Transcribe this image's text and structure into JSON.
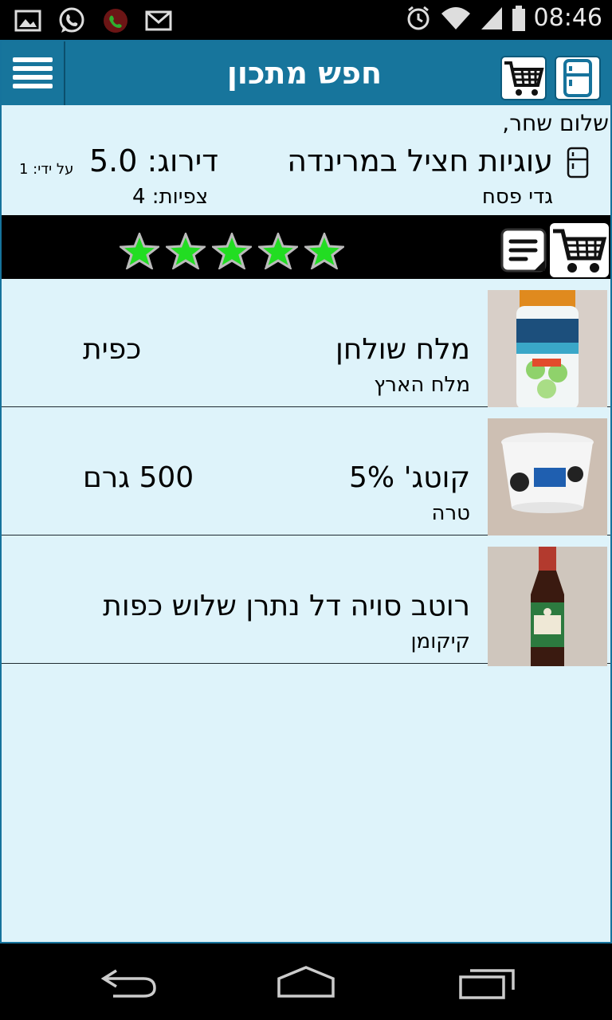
{
  "status_bar": {
    "time": "08:46",
    "left_icons": [
      "gallery-icon",
      "whatsapp-icon",
      "call-icon",
      "gmail-icon"
    ],
    "right_icons": [
      "alarm-icon",
      "wifi-icon",
      "signal-icon",
      "battery-icon"
    ]
  },
  "header": {
    "title": "חפש מתכון",
    "menu_icon": "hamburger-menu-icon",
    "cart_icon": "shopping-cart-icon",
    "fridge_icon": "fridge-icon",
    "background": "#17759c"
  },
  "recipe": {
    "greeting": "שלום שחר,",
    "name": "עוגיות חציל במרינדה",
    "author": "גדי פסח",
    "rating": "דירוג: 5.0",
    "views": "צפיות: 4",
    "by": "על ידי: 1",
    "stars_filled": 5,
    "stars_total": 5
  },
  "actions": {
    "notes_icon": "notes-icon",
    "cart_icon": "add-to-cart-icon",
    "star_color": "#22dd22"
  },
  "ingredients": [
    {
      "name": "מלח שולחן",
      "brand": "מלח הארץ",
      "quantity": "כפית",
      "thumb_icon": "salt-product-image"
    },
    {
      "name": "קוטג' 5%",
      "brand": "טרה",
      "quantity": "500 גרם",
      "thumb_icon": "cottage-cheese-product-image"
    },
    {
      "name": "רוטב סויה דל נתרן שלוש כפות",
      "brand": "קיקומן",
      "quantity": "",
      "thumb_icon": "soy-sauce-product-image"
    }
  ],
  "nav": {
    "back_icon": "back-icon",
    "home_icon": "home-icon",
    "recents_icon": "recents-icon"
  },
  "colors": {
    "app_background": "#def3fa",
    "header": "#17759c",
    "action_bar": "#000000"
  }
}
